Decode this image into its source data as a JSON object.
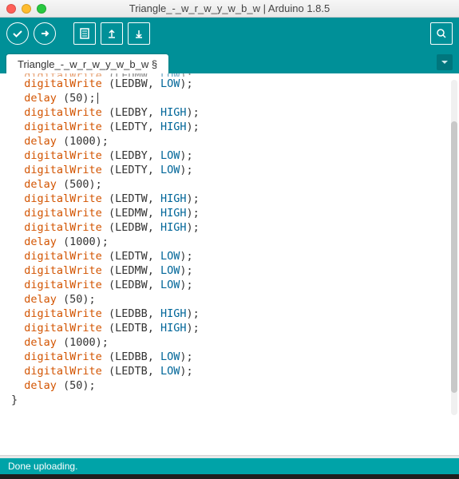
{
  "window": {
    "title": "Triangle_-_w_r_w_y_w_b_w | Arduino 1.8.5"
  },
  "tabs": {
    "main": "Triangle_-_w_r_w_y_w_b_w §"
  },
  "status": {
    "message": "Done uploading."
  },
  "code": {
    "lines": [
      {
        "type": "call",
        "fn": "digitalWrite",
        "args": [
          "LEDMW",
          "LOW"
        ],
        "cutTop": true
      },
      {
        "type": "call",
        "fn": "digitalWrite",
        "args": [
          "LEDBW",
          "LOW"
        ]
      },
      {
        "type": "call",
        "fn": "delay",
        "args": [
          "50"
        ],
        "cursor": true
      },
      {
        "type": "call",
        "fn": "digitalWrite",
        "args": [
          "LEDBY",
          "HIGH"
        ]
      },
      {
        "type": "call",
        "fn": "digitalWrite",
        "args": [
          "LEDTY",
          "HIGH"
        ]
      },
      {
        "type": "call",
        "fn": "delay",
        "args": [
          "1000"
        ]
      },
      {
        "type": "call",
        "fn": "digitalWrite",
        "args": [
          "LEDBY",
          "LOW"
        ]
      },
      {
        "type": "call",
        "fn": "digitalWrite",
        "args": [
          "LEDTY",
          "LOW"
        ]
      },
      {
        "type": "call",
        "fn": "delay",
        "args": [
          "500"
        ]
      },
      {
        "type": "call",
        "fn": "digitalWrite",
        "args": [
          "LEDTW",
          "HIGH"
        ]
      },
      {
        "type": "call",
        "fn": "digitalWrite",
        "args": [
          "LEDMW",
          "HIGH"
        ]
      },
      {
        "type": "call",
        "fn": "digitalWrite",
        "args": [
          "LEDBW",
          "HIGH"
        ]
      },
      {
        "type": "call",
        "fn": "delay",
        "args": [
          "1000"
        ]
      },
      {
        "type": "call",
        "fn": "digitalWrite",
        "args": [
          "LEDTW",
          "LOW"
        ]
      },
      {
        "type": "call",
        "fn": "digitalWrite",
        "args": [
          "LEDMW",
          "LOW"
        ]
      },
      {
        "type": "call",
        "fn": "digitalWrite",
        "args": [
          "LEDBW",
          "LOW"
        ]
      },
      {
        "type": "call",
        "fn": "delay",
        "args": [
          "50"
        ]
      },
      {
        "type": "call",
        "fn": "digitalWrite",
        "args": [
          "LEDBB",
          "HIGH"
        ]
      },
      {
        "type": "call",
        "fn": "digitalWrite",
        "args": [
          "LEDTB",
          "HIGH"
        ]
      },
      {
        "type": "call",
        "fn": "delay",
        "args": [
          "1000"
        ]
      },
      {
        "type": "call",
        "fn": "digitalWrite",
        "args": [
          "LEDBB",
          "LOW"
        ]
      },
      {
        "type": "call",
        "fn": "digitalWrite",
        "args": [
          "LEDTB",
          "LOW"
        ]
      },
      {
        "type": "call",
        "fn": "delay",
        "args": [
          "50"
        ]
      },
      {
        "type": "brace",
        "text": "}"
      }
    ]
  }
}
